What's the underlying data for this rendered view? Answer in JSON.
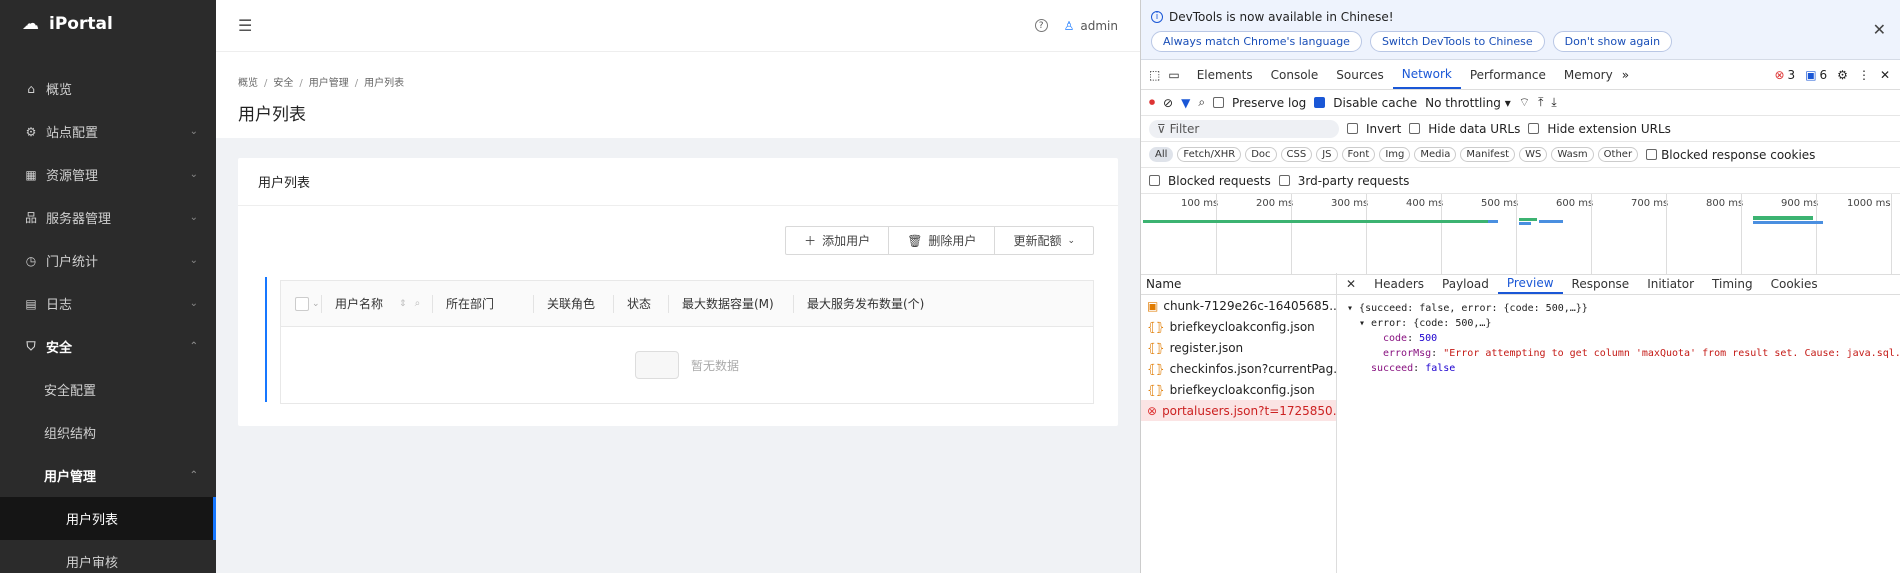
{
  "app": {
    "title": "iPortal"
  },
  "sidebar": {
    "items": [
      {
        "label": "概览",
        "icon": "home-icon"
      },
      {
        "label": "站点配置",
        "icon": "gear-icon"
      },
      {
        "label": "资源管理",
        "icon": "grid-icon"
      },
      {
        "label": "服务器管理",
        "icon": "cluster-icon"
      },
      {
        "label": "门户统计",
        "icon": "clock-icon"
      },
      {
        "label": "日志",
        "icon": "log-icon"
      },
      {
        "label": "安全",
        "icon": "shield-icon"
      },
      {
        "label": "安全配置"
      },
      {
        "label": "组织结构"
      },
      {
        "label": "用户管理"
      },
      {
        "label": "用户列表"
      },
      {
        "label": "用户审核"
      }
    ]
  },
  "topbar": {
    "user": "admin"
  },
  "breadcrumb": [
    "概览",
    "安全",
    "用户管理",
    "用户列表"
  ],
  "page": {
    "title": "用户列表"
  },
  "card": {
    "title": "用户列表",
    "buttons": {
      "add": "添加用户",
      "delete": "删除用户",
      "update": "更新配额"
    }
  },
  "table": {
    "columns": [
      "用户名称",
      "所在部门",
      "关联角色",
      "状态",
      "最大数据容量(M)",
      "最大服务发布数量(个)"
    ],
    "empty": "暂无数据"
  },
  "devtools": {
    "banner": {
      "message": "DevTools is now available in Chinese!",
      "btn1": "Always match Chrome's language",
      "btn2": "Switch DevTools to Chinese",
      "btn3": "Don't show again"
    },
    "tabs": [
      "Elements",
      "Console",
      "Sources",
      "Network",
      "Performance",
      "Memory"
    ],
    "errors": "3",
    "messages": "6",
    "toolbar": {
      "preserve": "Preserve log",
      "disable_cache": "Disable cache",
      "throttle": "No throttling"
    },
    "filter": {
      "placeholder": "Filter",
      "invert": "Invert",
      "hide_data": "Hide data URLs",
      "hide_ext": "Hide extension URLs"
    },
    "types": [
      "All",
      "Fetch/XHR",
      "Doc",
      "CSS",
      "JS",
      "Font",
      "Img",
      "Media",
      "Manifest",
      "WS",
      "Wasm",
      "Other"
    ],
    "blocked_cookies": "Blocked response cookies",
    "blocked_requests": "Blocked requests",
    "third_party": "3rd-party requests",
    "ticks": [
      "100 ms",
      "200 ms",
      "300 ms",
      "400 ms",
      "500 ms",
      "600 ms",
      "700 ms",
      "800 ms",
      "900 ms",
      "1000 ms"
    ],
    "name_header": "Name",
    "requests": [
      "chunk-7129e26c-16405685...",
      "briefkeycloakconfig.json",
      "register.json",
      "checkinfos.json?currentPag...",
      "briefkeycloakconfig.json",
      "portalusers.json?t=1725850..."
    ],
    "panel_tabs": [
      "Headers",
      "Payload",
      "Preview",
      "Response",
      "Initiator",
      "Timing",
      "Cookies"
    ],
    "preview": {
      "line1": "{succeed: false, error: {code: 500,…}}",
      "line2": "error: {code: 500,…}",
      "code_key": "code",
      "code_val": "500",
      "msg_key": "errorMsg",
      "msg_val": "\"Error attempting to get column 'maxQuota' from result set.  Cause: java.sql.SQLException\"",
      "succeed_key": "succeed",
      "succeed_val": "false"
    }
  }
}
